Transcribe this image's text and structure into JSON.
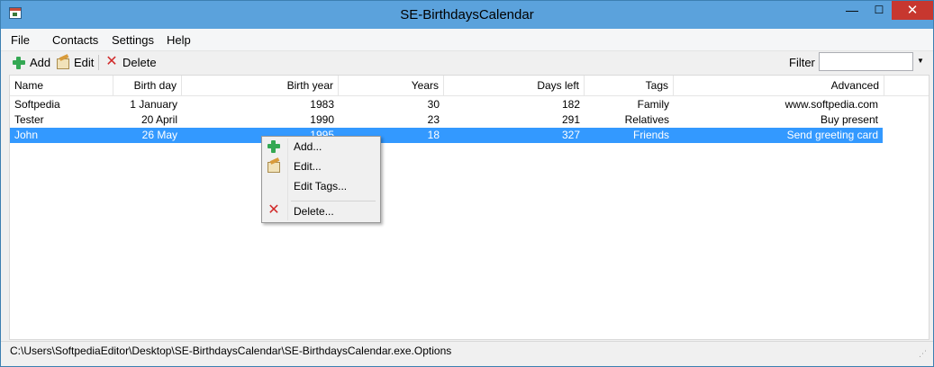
{
  "window": {
    "title": "SE-BirthdaysCalendar"
  },
  "titlebar": {
    "minimize_glyph": "—",
    "maximize_glyph": "☐",
    "close_glyph": "✕"
  },
  "menu": {
    "items": [
      "File",
      "Contacts",
      "Settings",
      "Help"
    ]
  },
  "toolbar": {
    "add_label": "Add",
    "edit_label": "Edit",
    "delete_label": "Delete",
    "filter_label": "Filter",
    "filter_value": "",
    "filter_dropdown_glyph": "▼"
  },
  "table": {
    "columns": [
      "Name",
      "Birth day",
      "Birth year",
      "Years",
      "Days left",
      "Tags",
      "Advanced"
    ],
    "rows": [
      [
        "Softpedia",
        "1 January",
        "1983",
        "30",
        "182",
        "Family",
        "www.softpedia.com"
      ],
      [
        "Tester",
        "20 April",
        "1990",
        "23",
        "291",
        "Relatives",
        "Buy present"
      ],
      [
        "John",
        "26 May",
        "1995",
        "18",
        "327",
        "Friends",
        "Send greeting card"
      ]
    ],
    "selected_row": 2
  },
  "context_menu": {
    "items": [
      {
        "label": "Add...",
        "icon": "plus-icon"
      },
      {
        "label": "Edit...",
        "icon": "edit-icon"
      },
      {
        "label": "Edit Tags...",
        "icon": ""
      },
      {
        "label": "Delete...",
        "icon": "delete-icon"
      }
    ]
  },
  "status": {
    "path": "C:\\Users\\SoftpediaEditor\\Desktop\\SE-BirthdaysCalendar\\SE-BirthdaysCalendar.exe.Options",
    "grip_glyph": "⋰"
  },
  "colors": {
    "titlebar": "#5ba2dc",
    "close_button": "#c7372f",
    "selection": "#3399ff",
    "add_icon": "#34a853",
    "delete_icon": "#d12a2a"
  }
}
